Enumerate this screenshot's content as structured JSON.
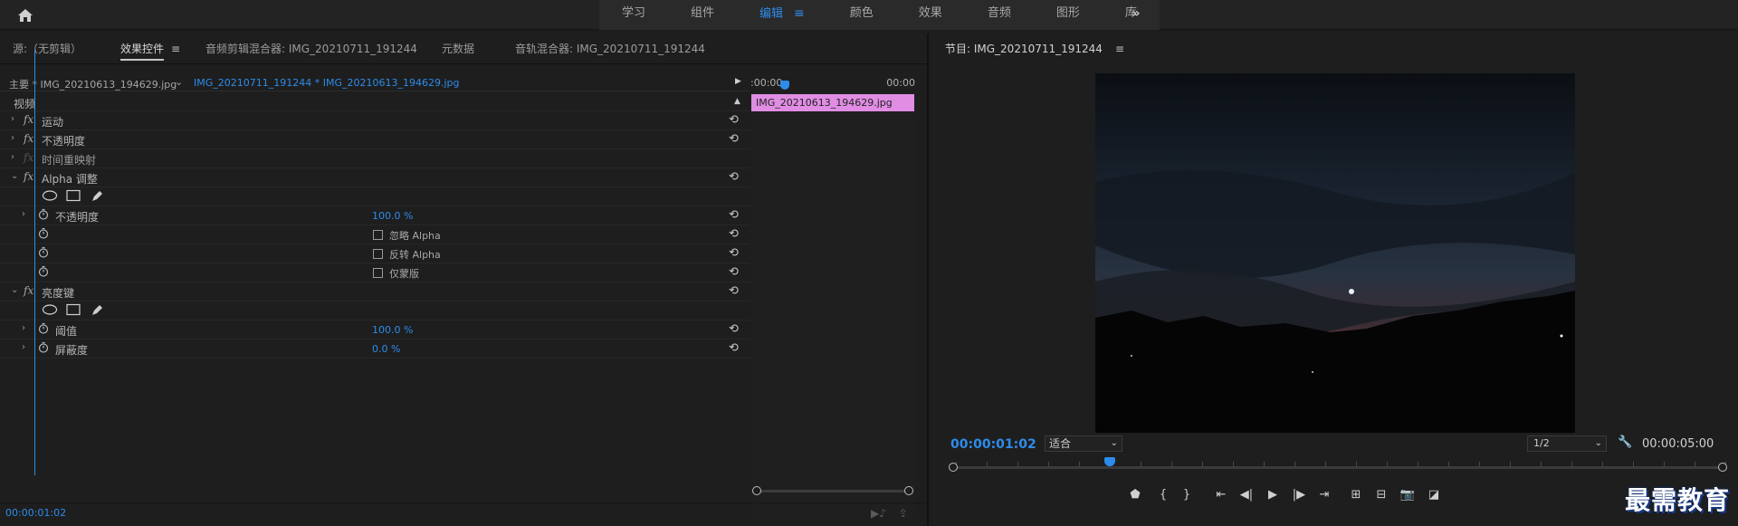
{
  "topbar": {
    "workspaces": [
      {
        "label": "学习",
        "active": false
      },
      {
        "label": "组件",
        "active": false
      },
      {
        "label": "编辑",
        "active": true
      },
      {
        "label": "颜色",
        "active": false
      },
      {
        "label": "效果",
        "active": false
      },
      {
        "label": "音频",
        "active": false
      },
      {
        "label": "图形",
        "active": false
      },
      {
        "label": "库",
        "active": false
      }
    ],
    "active_menu_icon": "hamburger-icon",
    "more_label": "»"
  },
  "left_panel": {
    "tabs": [
      {
        "label": "源:（无剪辑）"
      },
      {
        "label": "效果控件",
        "active": true
      },
      {
        "label": "音频剪辑混合器: IMG_20210711_191244"
      },
      {
        "label": "元数据"
      },
      {
        "label": "音轨混合器: IMG_20210711_191244"
      }
    ],
    "master_label": "主要 * IMG_20210613_194629.jpg",
    "sequence_clip": "IMG_20210711_191244 * IMG_20210613_194629.jpg",
    "ruler_start": ":00:00",
    "ruler_end": "00:00",
    "clip_name": "IMG_20210613_194629.jpg",
    "video_header": "视频",
    "effects": {
      "motion": "运动",
      "opacity": "不透明度",
      "time_remap": "时间重映射",
      "alpha_adjust": "Alpha 调整",
      "alpha_opacity_label": "不透明度",
      "alpha_opacity_value": "100.0 %",
      "ignore_alpha": "忽略 Alpha",
      "invert_alpha": "反转 Alpha",
      "mask_only": "仅蒙版",
      "luma_key": "亮度键",
      "threshold_label": "阈值",
      "threshold_value": "100.0 %",
      "cutoff_label": "屏蔽度",
      "cutoff_value": "0.0 %"
    },
    "footer_time": "00:00:01:02"
  },
  "program": {
    "title": "节目: IMG_20210711_191244",
    "timecode_current": "00:00:01:02",
    "fit_label": "适合",
    "resolution_label": "1/2",
    "timecode_duration": "00:00:05:00",
    "playhead_fraction": 0.2
  },
  "watermark": "最需教育",
  "colors": {
    "accent": "#2d8ceb",
    "clip": "#e08de3",
    "background": "#1d1d1d"
  }
}
